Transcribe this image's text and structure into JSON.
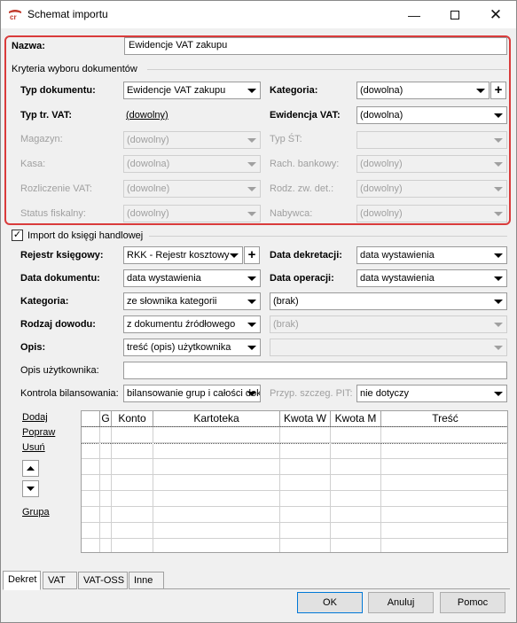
{
  "window": {
    "title": "Schemat importu",
    "icons": [
      "app-logo-icon",
      "minimize-icon",
      "maximize-icon",
      "close-icon"
    ]
  },
  "top": {
    "name_label": "Nazwa:",
    "name_value": "Ewidencje VAT zakupu",
    "criteria_header": "Kryteria wyboru dokumentów",
    "typ_dokumentu": {
      "label": "Typ dokumentu:",
      "value": "Ewidencje VAT zakupu"
    },
    "kategoria": {
      "label": "Kategoria:",
      "value": "(dowolna)"
    },
    "typ_tr_vat": {
      "label": "Typ tr. VAT:",
      "value": "(dowolny)"
    },
    "ewidencja_vat": {
      "label": "Ewidencja VAT:",
      "value": "(dowolna)"
    },
    "magazyn": {
      "label": "Magazyn:",
      "value": "(dowolny)"
    },
    "typ_st": {
      "label": "Typ ŚT:",
      "value": ""
    },
    "kasa": {
      "label": "Kasa:",
      "value": "(dowolna)"
    },
    "rach_bankowy": {
      "label": "Rach. bankowy:",
      "value": "(dowolny)"
    },
    "rozliczenie_vat": {
      "label": "Rozliczenie VAT:",
      "value": "(dowolne)"
    },
    "rodz_zw_det": {
      "label": "Rodz. zw. det.:",
      "value": "(dowolny)"
    },
    "status_fiskalny": {
      "label": "Status fiskalny:",
      "value": "(dowolny)"
    },
    "nabywca": {
      "label": "Nabywca:",
      "value": "(dowolny)"
    }
  },
  "import": {
    "checkbox_label": "Import do księgi handlowej",
    "checked": true,
    "rejestr": {
      "label": "Rejestr księgowy:",
      "value": "RKK - Rejestr kosztowy"
    },
    "data_dekretacji": {
      "label": "Data dekretacji:",
      "value": "data wystawienia"
    },
    "data_dokumentu": {
      "label": "Data dokumentu:",
      "value": "data wystawienia"
    },
    "data_operacji": {
      "label": "Data operacji:",
      "value": "data wystawienia"
    },
    "kategoria": {
      "label": "Kategoria:",
      "value": "ze słownika kategorii",
      "value2": "(brak)"
    },
    "rodzaj_dowodu": {
      "label": "Rodzaj dowodu:",
      "value": "z dokumentu źródłowego",
      "value2": "(brak)"
    },
    "opis": {
      "label": "Opis:",
      "value": "treść (opis) użytkownika",
      "value2": ""
    },
    "opis_uzytkownika": {
      "label": "Opis użytkownika:",
      "value": ""
    },
    "kontrola": {
      "label": "Kontrola bilansowania:",
      "value": "bilansowanie grup i całości dokumentu"
    },
    "przyp_szczeg_pit": {
      "label": "Przyp. szczeg. PIT:",
      "value": "nie dotyczy"
    }
  },
  "grid": {
    "links": {
      "dodaj": "Dodaj",
      "popraw": "Popraw",
      "usun": "Usuń",
      "grupa": "Grupa"
    },
    "columns": [
      "",
      "G",
      "Konto",
      "Kartoteka",
      "Kwota W",
      "Kwota M",
      "Treść"
    ]
  },
  "tabs": [
    "Dekret",
    "VAT",
    "VAT-OSS",
    "Inne"
  ],
  "buttons": {
    "ok": "OK",
    "cancel": "Anuluj",
    "help": "Pomoc"
  }
}
